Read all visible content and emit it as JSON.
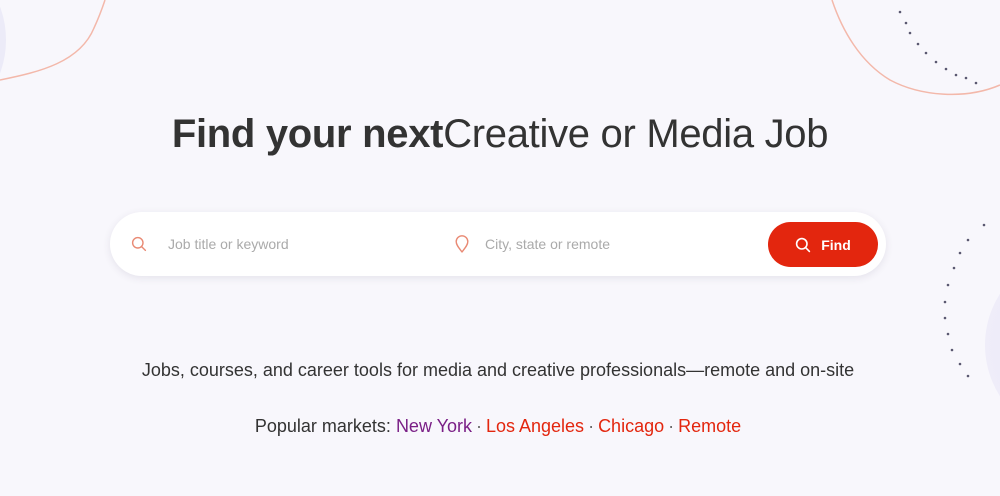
{
  "hero": {
    "title_strong": "Find your next",
    "title_rest": "Creative or Media Job"
  },
  "search": {
    "keyword_placeholder": "Job title or keyword",
    "location_placeholder": "City, state or remote",
    "button_label": "Find",
    "icons": {
      "keyword": "search-icon",
      "location": "location-pin-icon",
      "button": "search-icon"
    }
  },
  "tagline": "Jobs, courses, and career tools for media and creative professionals—remote and on-site",
  "markets": {
    "label": "Popular markets:",
    "separator": "·",
    "items": [
      {
        "label": "New York",
        "color": "#7a1f86"
      },
      {
        "label": "Los Angeles",
        "color": "#e3260e"
      },
      {
        "label": "Chicago",
        "color": "#e3260e"
      },
      {
        "label": "Remote",
        "color": "#e3260e"
      }
    ]
  },
  "colors": {
    "accent": "#e3260e",
    "background": "#f8f7fc",
    "decor_curve": "#f3b8aa",
    "decor_dots": "#5a5870"
  }
}
